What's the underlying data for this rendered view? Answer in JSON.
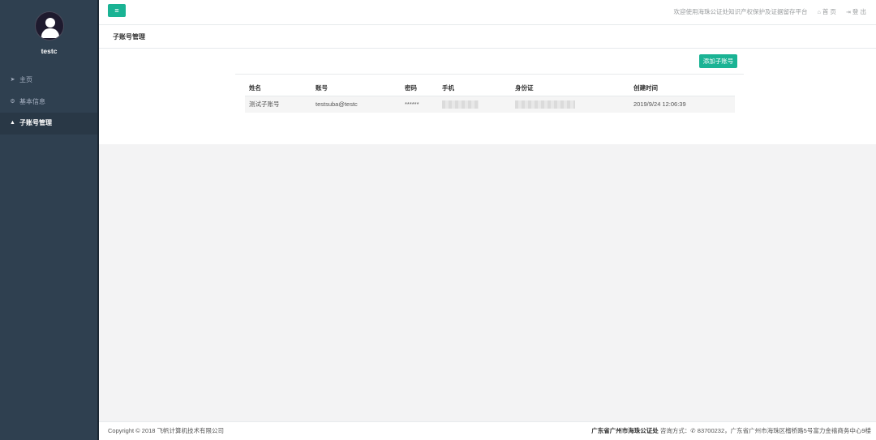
{
  "sidebar": {
    "username": "testc",
    "items": [
      {
        "label": "主页",
        "icon": "paper-plane-icon"
      },
      {
        "label": "基本信息",
        "icon": "gear-icon"
      },
      {
        "label": "子账号管理",
        "icon": "user-icon",
        "active": true
      }
    ]
  },
  "topbar": {
    "menu_icon": "hamburger-icon",
    "welcome": "欢迎使用海珠公证处知识产权保护及证据留存平台",
    "home": "首 页",
    "logout": "登 出"
  },
  "breadcrumb": {
    "title": "子账号管理"
  },
  "toolbar": {
    "add_label": "添加子账号"
  },
  "table": {
    "headers": [
      "姓名",
      "账号",
      "密码",
      "手机",
      "身份证",
      "创建时间"
    ],
    "rows": [
      {
        "name": "测试子账号",
        "account": "testsuba@testc",
        "password": "******",
        "phone": "",
        "id_card": "",
        "created": "2019/9/24 12:06:39"
      }
    ]
  },
  "footer": {
    "copyright": "Copyright © 2018 飞帆计算机技术有限公司",
    "org": "广东省广州市海珠公证处",
    "contact_label": "咨询方式：",
    "phone": "83700232",
    "address": "，广东省广州市海珠区榴桥路5号富力金禧商务中心9楼"
  },
  "colors": {
    "accent": "#1ab394",
    "sidebar_bg": "#2f4050",
    "sidebar_active": "#293846"
  }
}
